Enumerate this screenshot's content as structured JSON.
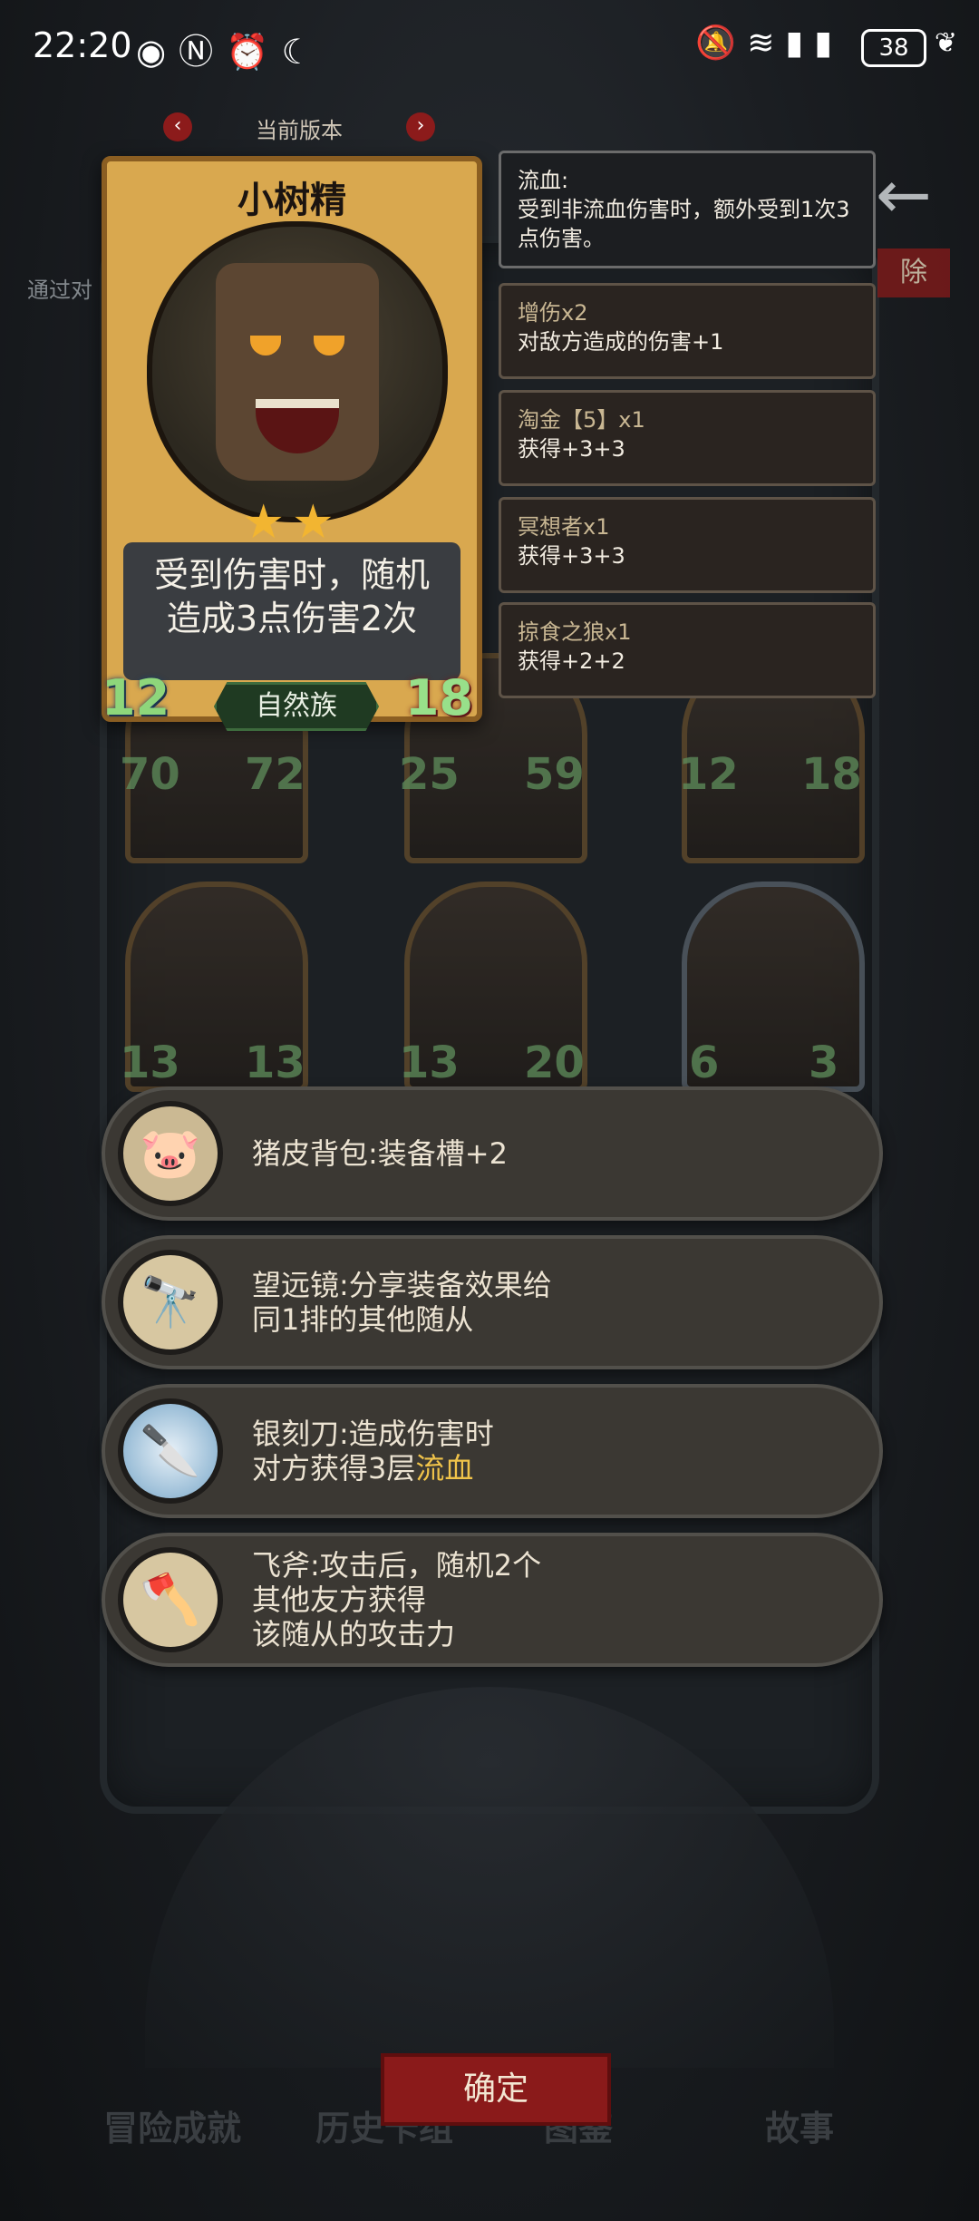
{
  "status_bar": {
    "time": "22:20",
    "battery": "38"
  },
  "version": {
    "label": "当前版本"
  },
  "remove_label": "除",
  "hint_text": "通过对",
  "hero": {
    "name": "小树精",
    "description_line1": "受到伤害时，随机",
    "description_line2": "造成3点伤害2次",
    "attack": "12",
    "health": "18",
    "tribe": "自然族",
    "stars": "★★"
  },
  "effects": [
    {
      "title": "流血:",
      "body": "受到非流血伤害时，额外受到1次3点伤害。"
    },
    {
      "title": "增伤x2",
      "body": "对敌方造成的伤害+1"
    },
    {
      "title": "淘金【5】x1",
      "body": "获得+3+3"
    },
    {
      "title": "冥想者x1",
      "body": "获得+3+3"
    },
    {
      "title": "掠食之狼x1",
      "body": "获得+2+2"
    }
  ],
  "minions": [
    {
      "atk": "70",
      "hp": "72"
    },
    {
      "atk": "25",
      "hp": "59"
    },
    {
      "atk": "12",
      "hp": "18"
    },
    {
      "atk": "13",
      "hp": "13"
    },
    {
      "atk": "13",
      "hp": "20"
    },
    {
      "atk": "6",
      "hp": "3"
    }
  ],
  "items": [
    {
      "icon": "pig-bag-icon",
      "text": "猪皮背包:装备槽+2"
    },
    {
      "icon": "telescope-icon",
      "text": "望远镜:分享装备效果给\n同1排的其他随从"
    },
    {
      "icon": "silver-knife-icon",
      "text_pre": "银刻刀:造成伤害时\n对方获得3层",
      "text_hl": "流血"
    },
    {
      "icon": "axe-icon",
      "text": "飞斧:攻击后，随机2个\n其他友方获得\n该随从的攻击力"
    }
  ],
  "nav": {
    "achievements": "冒险成就",
    "history": "历史卡组",
    "codex": "图鉴",
    "story": "故事",
    "confirm": "确定"
  }
}
